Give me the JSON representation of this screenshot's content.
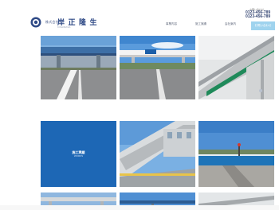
{
  "header": {
    "logo_small": "株式会社",
    "logo_name": "岸 正 隆 生",
    "logo_sub": "KISHIMASA",
    "nav": [
      "事業内容",
      "施工実績",
      "会社案内",
      "採用情報"
    ],
    "contact_label": "お問い合わせ",
    "phone_1": "0123-456-789",
    "phone_2": "0123-456-789",
    "contact_button": "お問い合わせ"
  },
  "grid": {
    "featured_title": "施工実績",
    "featured_sub": "WORKS"
  },
  "colors": {
    "brand": "#2f4a86",
    "featured_tile": "#1d67b5",
    "contact_button": "#9fd3ee"
  }
}
